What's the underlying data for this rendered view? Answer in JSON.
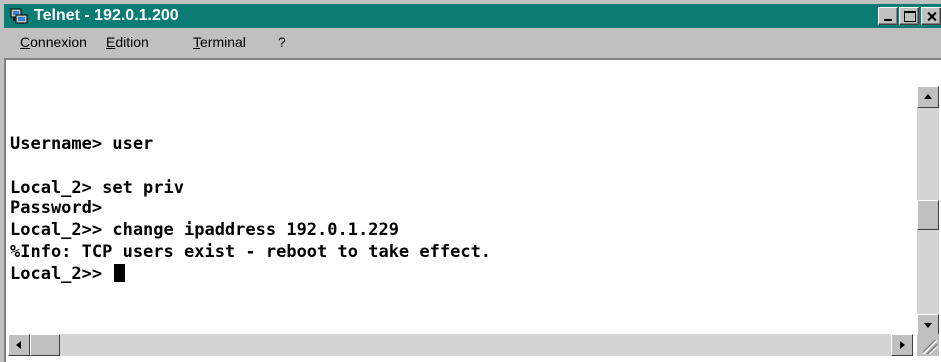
{
  "window": {
    "title": "Telnet - 192.0.1.200",
    "app_icon": "telnet-computer-icon",
    "controls": [
      "minimize-icon",
      "maximize-icon",
      "close-icon"
    ]
  },
  "menu": {
    "items": [
      {
        "label": "Connexion"
      },
      {
        "label": "Edition"
      },
      {
        "label": "Terminal"
      },
      {
        "label": "?"
      }
    ]
  },
  "terminal": {
    "lines": [
      "Username> user",
      "Local_2> set priv",
      "Password>",
      "Local_2>> change ipaddress 192.0.1.229",
      "%Info: TCP users exist - reboot to take effect.",
      "Local_2>> "
    ]
  },
  "colors": {
    "titlebar": "#0a7c74",
    "chrome": "#c0c0c0",
    "terminal_bg": "#ffffff",
    "terminal_fg": "#000000"
  }
}
